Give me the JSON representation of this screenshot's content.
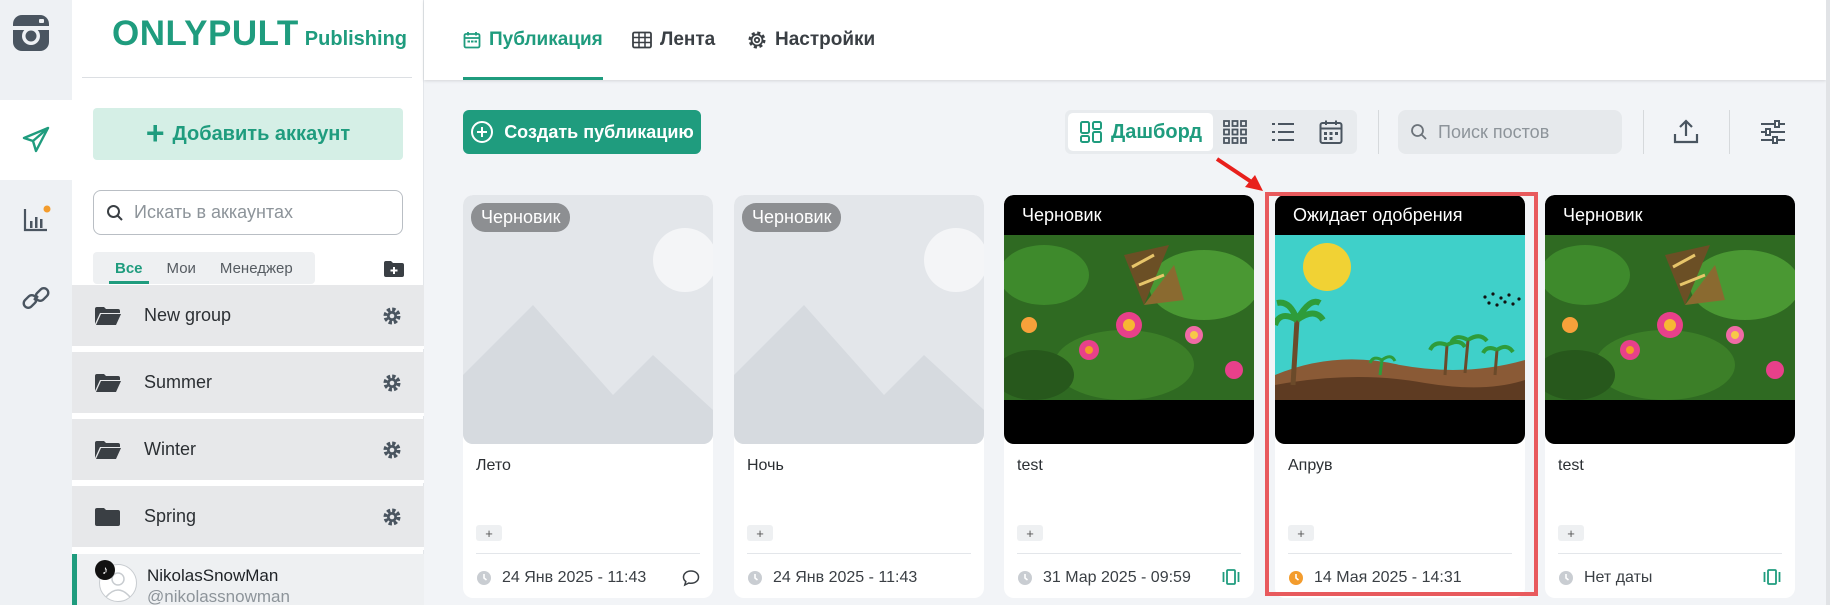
{
  "brand": {
    "name": "ONLYPULT",
    "sub": "Publishing"
  },
  "sidebar": {
    "add_account": "Добавить аккаунт",
    "search_placeholder": "Искать в аккаунтах",
    "tabs": [
      {
        "label": "Все",
        "active": true
      },
      {
        "label": "Мои",
        "active": false
      },
      {
        "label": "Менеджер",
        "active": false
      }
    ],
    "groups": [
      {
        "label": "New group"
      },
      {
        "label": "Summer"
      },
      {
        "label": "Winter"
      },
      {
        "label": "Spring"
      }
    ],
    "account": {
      "name": "NikolasSnowMan",
      "handle": "@nikolassnowman"
    }
  },
  "topbar": {
    "tabs": [
      {
        "label": "Публикация",
        "icon": "calendar-icon",
        "active": true
      },
      {
        "label": "Лента",
        "icon": "grid-table-icon",
        "active": false
      },
      {
        "label": "Настройки",
        "icon": "gear-icon",
        "active": false
      }
    ]
  },
  "toolbar": {
    "create_label": "Создать публикацию",
    "view_dashboard_label": "Дашборд",
    "search_placeholder": "Поиск постов"
  },
  "colors": {
    "accent": "#1f9c7e",
    "highlight": "#e85a5d",
    "pending_clock": "#f39c2d"
  },
  "cards": [
    {
      "status": "Черновик",
      "status_style": "pill",
      "image": "placeholder",
      "title": "Лето",
      "date": "24 Янв 2025 - 11:43",
      "foot_icon": "comment-icon"
    },
    {
      "status": "Черновик",
      "status_style": "pill",
      "image": "placeholder",
      "title": "Ночь",
      "date": "24 Янв 2025 - 11:43",
      "foot_icon": ""
    },
    {
      "status": "Черновик",
      "status_style": "bar",
      "image": "butterfly",
      "title": "test",
      "date": "31 Мар 2025 - 09:59",
      "foot_icon": "carousel-icon"
    },
    {
      "status": "Ожидает одобрения",
      "status_style": "bar",
      "image": "beach",
      "title": "Апрув",
      "date": "14 Мая 2025 - 14:31",
      "foot_icon": ""
    },
    {
      "status": "Черновик",
      "status_style": "bar",
      "image": "butterfly",
      "title": "test",
      "date": "Нет даты",
      "foot_icon": "carousel-icon"
    }
  ]
}
